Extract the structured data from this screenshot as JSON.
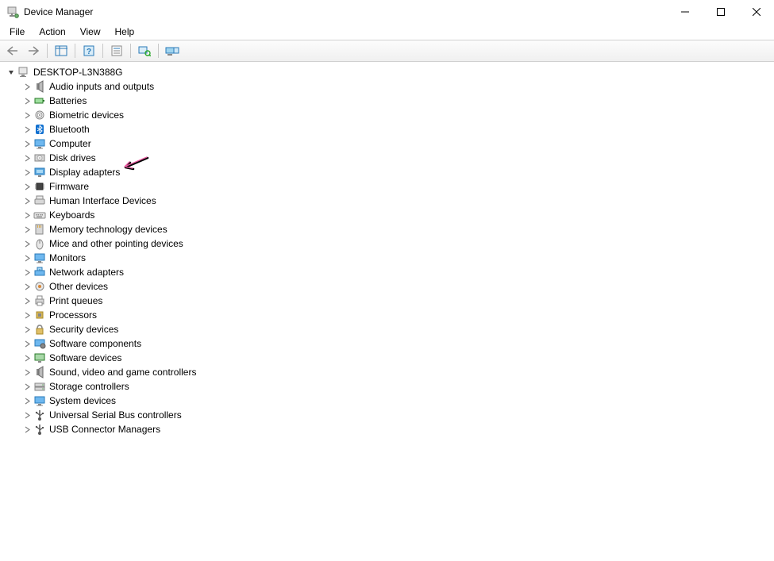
{
  "title": "Device Manager",
  "menu": {
    "file": "File",
    "action": "Action",
    "view": "View",
    "help": "Help"
  },
  "tree": {
    "root": {
      "label": "DESKTOP-L3N388G",
      "expanded": true
    },
    "categories": [
      {
        "id": "audio",
        "label": "Audio inputs and outputs",
        "icon": "speaker"
      },
      {
        "id": "batteries",
        "label": "Batteries",
        "icon": "battery"
      },
      {
        "id": "biometric",
        "label": "Biometric devices",
        "icon": "fingerprint"
      },
      {
        "id": "bluetooth",
        "label": "Bluetooth",
        "icon": "bluetooth"
      },
      {
        "id": "computer",
        "label": "Computer",
        "icon": "monitor"
      },
      {
        "id": "diskdrives",
        "label": "Disk drives",
        "icon": "disk"
      },
      {
        "id": "display",
        "label": "Display adapters",
        "icon": "display"
      },
      {
        "id": "firmware",
        "label": "Firmware",
        "icon": "chip"
      },
      {
        "id": "hid",
        "label": "Human Interface Devices",
        "icon": "hid"
      },
      {
        "id": "keyboards",
        "label": "Keyboards",
        "icon": "keyboard"
      },
      {
        "id": "memtech",
        "label": "Memory technology devices",
        "icon": "memcard"
      },
      {
        "id": "mice",
        "label": "Mice and other pointing devices",
        "icon": "mouse"
      },
      {
        "id": "monitors",
        "label": "Monitors",
        "icon": "monitor"
      },
      {
        "id": "network",
        "label": "Network adapters",
        "icon": "network"
      },
      {
        "id": "other",
        "label": "Other devices",
        "icon": "other"
      },
      {
        "id": "printq",
        "label": "Print queues",
        "icon": "printer"
      },
      {
        "id": "processors",
        "label": "Processors",
        "icon": "cpu"
      },
      {
        "id": "security",
        "label": "Security devices",
        "icon": "lock"
      },
      {
        "id": "swcomp",
        "label": "Software components",
        "icon": "swcomp"
      },
      {
        "id": "swdev",
        "label": "Software devices",
        "icon": "swdev"
      },
      {
        "id": "sound",
        "label": "Sound, video and game controllers",
        "icon": "speaker"
      },
      {
        "id": "storage",
        "label": "Storage controllers",
        "icon": "storage"
      },
      {
        "id": "system",
        "label": "System devices",
        "icon": "monitor"
      },
      {
        "id": "usb",
        "label": "Universal Serial Bus controllers",
        "icon": "usb"
      },
      {
        "id": "usbconn",
        "label": "USB Connector Managers",
        "icon": "usb"
      }
    ]
  }
}
